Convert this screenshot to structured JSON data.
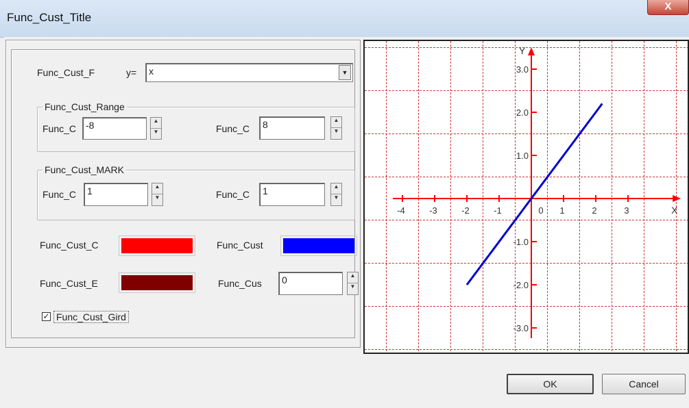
{
  "window": {
    "title": "Func_Cust_Title",
    "close_label": "X"
  },
  "function_row": {
    "label": "Func_Cust_F",
    "prefix": "y=",
    "value": "x",
    "dropdown_icon": "chevron-down-icon"
  },
  "range": {
    "group_label": "Func_Cust_Range",
    "min_label": "Func_C",
    "min_value": "-8",
    "max_label": "Func_C",
    "max_value": "8"
  },
  "mark": {
    "group_label": "Func_Cust_MARK",
    "x_label": "Func_C",
    "x_value": "1",
    "y_label": "Func_C",
    "y_value": "1"
  },
  "colors": {
    "axis_label": "Func_Cust_C",
    "axis_color": "#ff0000",
    "curve_label": "Func_Cust",
    "curve_color": "#0000ff",
    "bg_label": "Func_Cust_E",
    "bg_color": "#800000",
    "width_label": "Func_Cus",
    "width_value": "0"
  },
  "grid_checkbox": {
    "label": "Func_Cust_Gird",
    "checked": true,
    "check_mark": "✓"
  },
  "buttons": {
    "ok": "OK",
    "cancel": "Cancel"
  },
  "chart_data": {
    "type": "line",
    "x_axis_label": "X",
    "y_axis_label": "Y",
    "x_ticks": [
      "-4",
      "-3",
      "-2",
      "-1",
      "0",
      "1",
      "2",
      "3"
    ],
    "y_ticks": [
      "3.0",
      "2.0",
      "1.0",
      "-1.0",
      "-2.0",
      "-3.0"
    ],
    "xlim": [
      -4.5,
      4.5
    ],
    "ylim": [
      -3.5,
      3.5
    ],
    "grid": true,
    "axis_color": "#ff0000",
    "grid_color": "#cc3333",
    "series": [
      {
        "color": "#0000cc",
        "x": [
          -2.0,
          2.2
        ],
        "y": [
          -2.0,
          2.2
        ]
      }
    ]
  }
}
